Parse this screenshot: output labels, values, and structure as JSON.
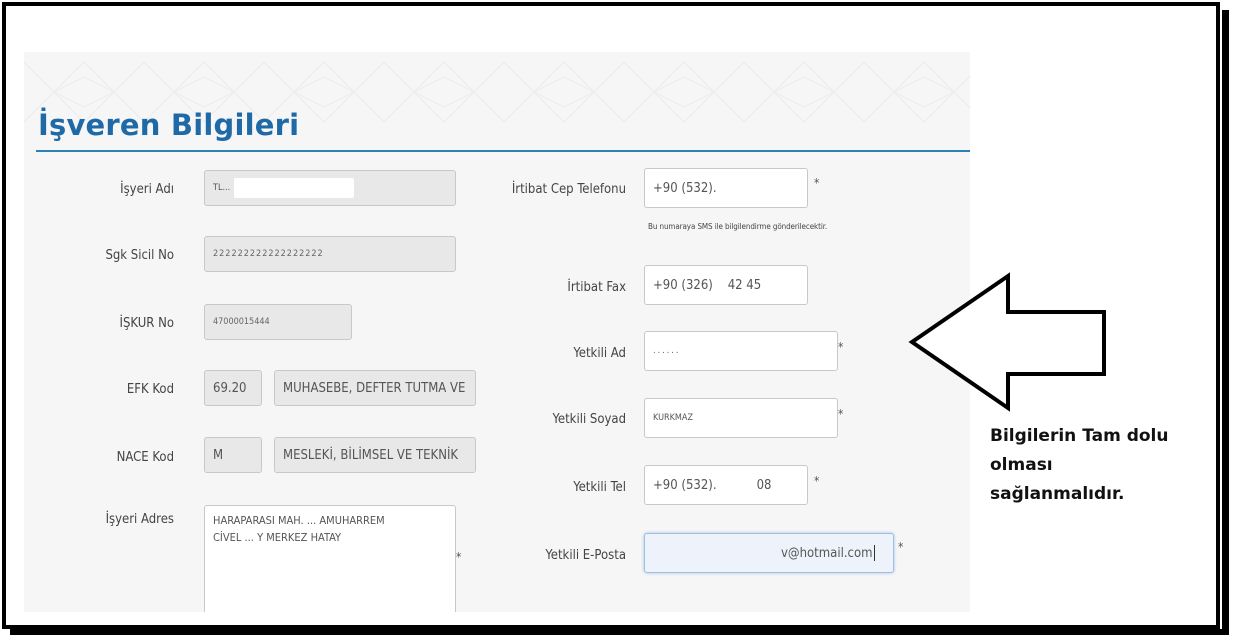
{
  "page": {
    "title": "İşveren Bilgileri"
  },
  "left_fields": [
    {
      "label": "İşyeri Adı",
      "value": "TL...",
      "masked": true
    },
    {
      "label": "Sgk Sicil No",
      "value": "222222222222222222",
      "masked": true
    },
    {
      "label": "İŞKUR No",
      "value": "47000015444",
      "masked": false
    },
    {
      "label": "EFK Kod",
      "code": "69.20",
      "value": "MUHASEBE, DEFTER TUTMA VE"
    },
    {
      "label": "NACE Kod",
      "code": "M",
      "value": "MESLEKİ, BİLİMSEL VE TEKNİK"
    },
    {
      "label": "İşyeri Adres",
      "value_line1": "HARAPARASI MAH. ... AMUHARREM",
      "value_line2": "CİVEL ... Y MERKEZ HATAY"
    }
  ],
  "right_fields": [
    {
      "label": "İrtibat Cep Telefonu",
      "value": "+90 (532).",
      "required": true
    },
    {
      "label": "İrtibat Fax",
      "value": "+90 (326)    42 45",
      "required": false
    },
    {
      "label": "Yetkili Ad",
      "value": "......",
      "required": true
    },
    {
      "label": "Yetkili Soyad",
      "value": "KURKMAZ",
      "required": true
    },
    {
      "label": "Yetkili Tel",
      "value": "+90 (532).",
      "value_tail": "08",
      "required": true
    },
    {
      "label": "Yetkili E-Posta",
      "value": "v@hotmail.com",
      "required": true
    }
  ],
  "sms_hint": "Bu numaraya SMS ile bilgilendirme gönderilecektir.",
  "required_mark": "*",
  "callout": {
    "line1": "Bilgilerin Tam dolu olması",
    "line2": "sağlanmalıdır."
  },
  "colors": {
    "title": "#1f6aa6",
    "rule": "#2d7fb8",
    "readonly_bg": "#e8e8e8"
  }
}
